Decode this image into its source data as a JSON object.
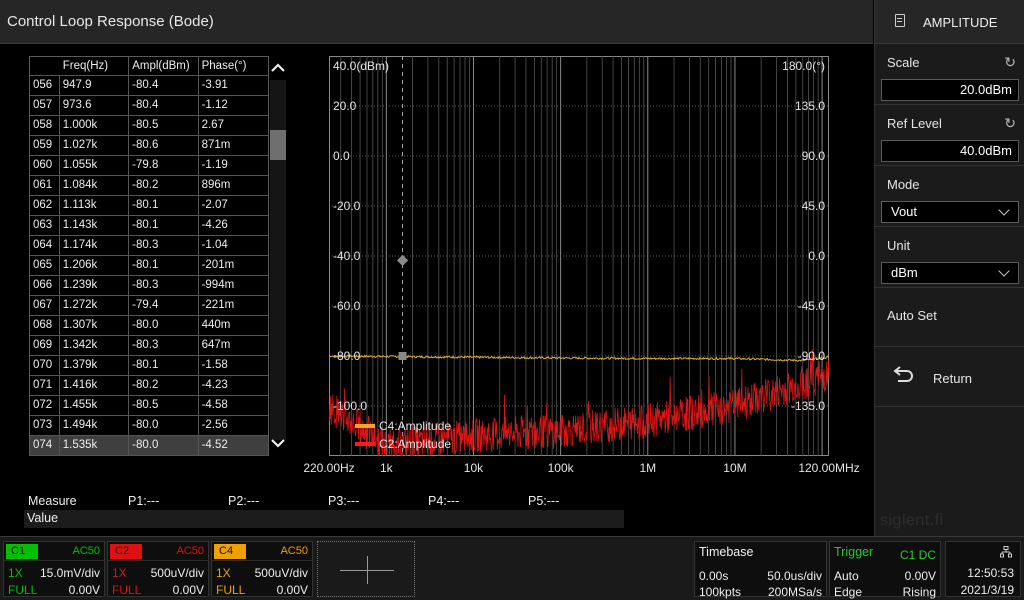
{
  "window": {
    "title": "Control Loop Response (Bode)"
  },
  "panel": {
    "header": "AMPLITUDE",
    "scale": {
      "label": "Scale",
      "value": "20.0dBm"
    },
    "ref_level": {
      "label": "Ref Level",
      "value": "40.0dBm"
    },
    "mode": {
      "label": "Mode",
      "value": "Vout"
    },
    "unit": {
      "label": "Unit",
      "value": "dBm"
    },
    "auto_set": "Auto Set",
    "return": "Return"
  },
  "table": {
    "headers": [
      "",
      "Freq(Hz)",
      "Ampl(dBm)",
      "Phase(°)"
    ],
    "rows": [
      [
        "056",
        "947.9",
        "-80.4",
        "-3.91"
      ],
      [
        "057",
        "973.6",
        "-80.4",
        "-1.12"
      ],
      [
        "058",
        "1.000k",
        "-80.5",
        "2.67"
      ],
      [
        "059",
        "1.027k",
        "-80.6",
        "871m"
      ],
      [
        "060",
        "1.055k",
        "-79.8",
        "-1.19"
      ],
      [
        "061",
        "1.084k",
        "-80.2",
        "896m"
      ],
      [
        "062",
        "1.113k",
        "-80.1",
        "-2.07"
      ],
      [
        "063",
        "1.143k",
        "-80.1",
        "-4.26"
      ],
      [
        "064",
        "1.174k",
        "-80.3",
        "-1.04"
      ],
      [
        "065",
        "1.206k",
        "-80.1",
        "-201m"
      ],
      [
        "066",
        "1.239k",
        "-80.3",
        "-994m"
      ],
      [
        "067",
        "1.272k",
        "-79.4",
        "-221m"
      ],
      [
        "068",
        "1.307k",
        "-80.0",
        "440m"
      ],
      [
        "069",
        "1.342k",
        "-80.3",
        "647m"
      ],
      [
        "070",
        "1.379k",
        "-80.1",
        "-1.58"
      ],
      [
        "071",
        "1.416k",
        "-80.2",
        "-4.23"
      ],
      [
        "072",
        "1.455k",
        "-80.5",
        "-4.58"
      ],
      [
        "073",
        "1.494k",
        "-80.0",
        "-2.56"
      ],
      [
        "074",
        "1.535k",
        "-80.0",
        "-4.52"
      ]
    ],
    "selected_index": 18
  },
  "chart_data": {
    "type": "line",
    "left_axis_top_label": "40.0(dBm)",
    "right_axis_top_label": "180.0(°)",
    "left_ticks": [
      "20.0",
      "0.0",
      "-20.0",
      "-40.0",
      "-60.0",
      "-80.0",
      "-100.0"
    ],
    "right_ticks": [
      "135.0",
      "90.0",
      "45.0",
      "0.0",
      "-45.0",
      "-90.0",
      "-135.0"
    ],
    "x_ticks": [
      "220.00Hz",
      "1k",
      "10k",
      "100k",
      "1M",
      "10M",
      "120.00MHz"
    ],
    "x_range_hz": [
      220,
      120000000
    ],
    "ylim_dbm": [
      -120,
      40
    ],
    "ylim_deg": [
      -180,
      180
    ],
    "xscale": "log",
    "cursor_freq_hz": 1535,
    "cursor_markers": [
      {
        "label": "phase",
        "value": -3.91
      },
      {
        "label": "amplitude",
        "value": -80.0
      }
    ],
    "legend": [
      {
        "name": "C4:Amplitude",
        "color": "#f5a623"
      },
      {
        "name": "C2:Amplitude",
        "color": "#ff1a1a"
      }
    ],
    "series": [
      {
        "name": "C4:Amplitude",
        "color": "#e0b030",
        "approx_level_dbm": -80.0,
        "x": [
          220,
          1000,
          10000,
          100000,
          1000000,
          10000000,
          60000000,
          120000000
        ],
        "y": [
          -80.0,
          -80.2,
          -80.5,
          -80.8,
          -81.0,
          -81.0,
          -81.8,
          -80.5
        ]
      },
      {
        "name": "C2:Amplitude",
        "color": "#e01515",
        "x": [
          220,
          1000,
          10000,
          100000,
          1000000,
          10000000,
          40000000,
          120000000
        ],
        "y": [
          -100,
          -116,
          -112,
          -110,
          -106,
          -100,
          -93,
          -87
        ]
      }
    ]
  },
  "measure": {
    "label": "Measure",
    "p1": "P1:---",
    "p2": "P2:---",
    "p3": "P3:---",
    "p4": "P4:---",
    "p5": "P5:---",
    "value_label": "Value"
  },
  "watermark": "siglent.fi",
  "channels": [
    {
      "id": "C1",
      "coupling": "AC50",
      "probe": "1X",
      "scale": "15.0mV/div",
      "bw": "FULL",
      "offset": "0.00V",
      "color": "#00c000"
    },
    {
      "id": "C2",
      "coupling": "AC50",
      "probe": "1X",
      "scale": "500uV/div",
      "bw": "FULL",
      "offset": "0.00V",
      "color": "#e01010"
    },
    {
      "id": "C4",
      "coupling": "AC50",
      "probe": "1X",
      "scale": "500uV/div",
      "bw": "FULL",
      "offset": "0.00V",
      "color": "#f0a000"
    }
  ],
  "timebase": {
    "title": "Timebase",
    "delay": "0.00s",
    "scale": "50.0us/div",
    "points": "100kpts",
    "rate": "200MSa/s"
  },
  "trigger": {
    "title": "Trigger",
    "source": "C1 DC",
    "mode": "Auto",
    "level": "0.00V",
    "type": "Edge",
    "slope": "Rising"
  },
  "clock": {
    "time": "12:50:53",
    "date": "2021/3/19"
  }
}
